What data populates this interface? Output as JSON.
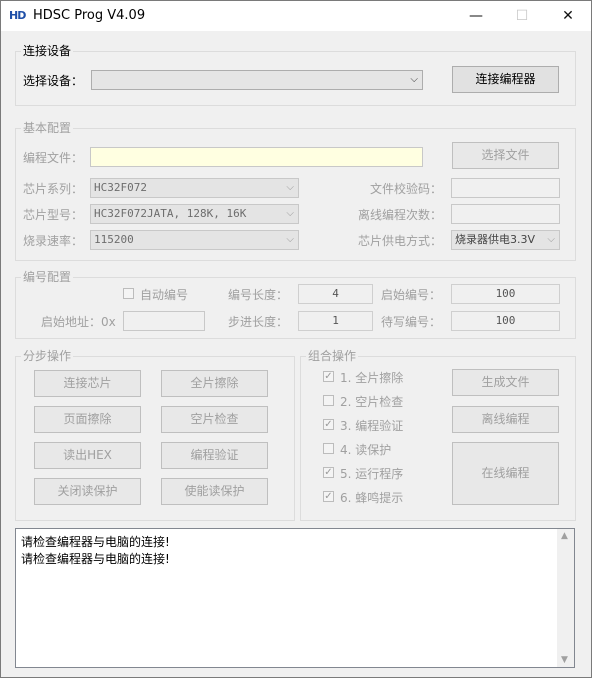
{
  "window": {
    "icon_text": "HD",
    "title": "HDSC Prog V4.09",
    "minimize": "—",
    "maximize": "☐",
    "close": "✕"
  },
  "connect": {
    "group_title": "连接设备",
    "select_label": "选择设备：",
    "device_value": "",
    "connect_button": "连接编程器"
  },
  "basic": {
    "group_title": "基本配置",
    "program_file_label": "编程文件：",
    "program_file_value": "",
    "select_file_button": "选择文件",
    "chip_series_label": "芯片系列：",
    "chip_series_value": "HC32F072",
    "chip_model_label": "芯片型号：",
    "chip_model_value": "HC32F072JATA, 128K, 16K",
    "burn_rate_label": "烧录速率：",
    "burn_rate_value": "115200",
    "checksum_label": "文件校验码：",
    "checksum_value": "",
    "offline_count_label": "离线编程次数：",
    "offline_count_value": "",
    "power_label": "芯片供电方式：",
    "power_value": "烧录器供电3.3V"
  },
  "numbering": {
    "group_title": "编号配置",
    "auto_label": "自动编号",
    "length_label": "编号长度：",
    "length_value": "4",
    "start_num_label": "启始编号：",
    "start_num_value": "100",
    "start_addr_label": "启始地址：0x",
    "start_addr_value": "",
    "step_label": "步进长度：",
    "step_value": "1",
    "pending_label": "待写编号：",
    "pending_value": "100"
  },
  "step_ops": {
    "group_title": "分步操作",
    "buttons": [
      "连接芯片",
      "全片擦除",
      "页面擦除",
      "空片检查",
      "读出HEX",
      "编程验证",
      "关闭读保护",
      "使能读保护"
    ]
  },
  "combo_ops": {
    "group_title": "组合操作",
    "items": [
      {
        "label": "1. 全片擦除",
        "checked": true
      },
      {
        "label": "2. 空片检查",
        "checked": false
      },
      {
        "label": "3. 编程验证",
        "checked": true
      },
      {
        "label": "4. 读保护",
        "checked": false
      },
      {
        "label": "5. 运行程序",
        "checked": true
      },
      {
        "label": "6. 蜂鸣提示",
        "checked": true
      }
    ],
    "generate_button": "生成文件",
    "offline_button": "离线编程",
    "online_button": "在线编程"
  },
  "log": {
    "lines": [
      "请检查编程器与电脑的连接!",
      "请检查编程器与电脑的连接!"
    ]
  },
  "colors": {
    "accent": "#1f4fa8",
    "disabled_text": "#a0a0a0",
    "file_field": "#ffffe1"
  }
}
